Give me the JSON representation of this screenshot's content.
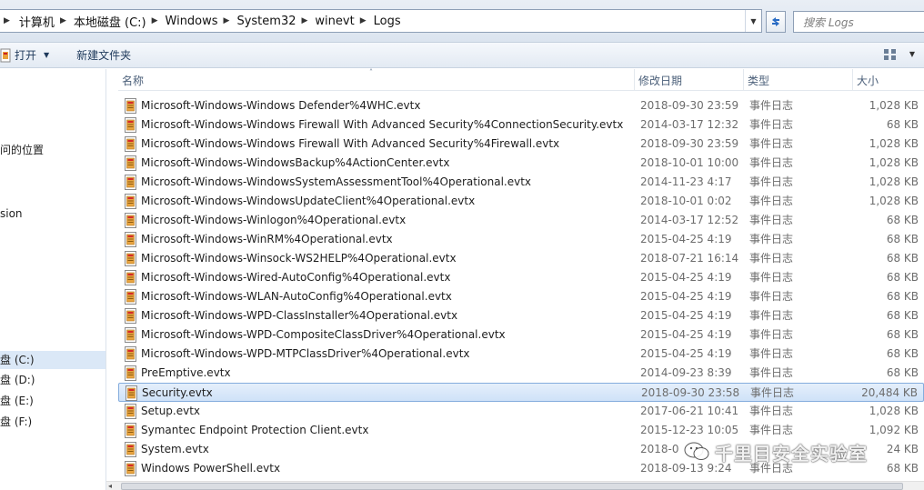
{
  "address_bar": {
    "crumbs": [
      "计算机",
      "本地磁盘 (C:)",
      "Windows",
      "System32",
      "winevt",
      "Logs"
    ]
  },
  "search": {
    "placeholder": "搜索 Logs"
  },
  "toolbar": {
    "open_label": "打开",
    "new_folder_label": "新建文件夹"
  },
  "nav": {
    "recent_places_partial": "问的位置",
    "partial_item": "sion",
    "drives": [
      {
        "label": "盘 (C:)",
        "selected": true
      },
      {
        "label": "盘 (D:)",
        "selected": false
      },
      {
        "label": "盘 (E:)",
        "selected": false
      },
      {
        "label": "盘 (F:)",
        "selected": false
      }
    ]
  },
  "columns": {
    "name": "名称",
    "date": "修改日期",
    "type": "类型",
    "size": "大小"
  },
  "files": [
    {
      "name": "Microsoft-Windows-Windows Defender%4WHC.evtx",
      "date": "2018-09-30 23:59",
      "type": "事件日志",
      "size": "1,028 KB"
    },
    {
      "name": "Microsoft-Windows-Windows Firewall With Advanced Security%4ConnectionSecurity.evtx",
      "date": "2014-03-17 12:32",
      "type": "事件日志",
      "size": "68 KB"
    },
    {
      "name": "Microsoft-Windows-Windows Firewall With Advanced Security%4Firewall.evtx",
      "date": "2018-09-30 23:59",
      "type": "事件日志",
      "size": "1,028 KB"
    },
    {
      "name": "Microsoft-Windows-WindowsBackup%4ActionCenter.evtx",
      "date": "2018-10-01 10:00",
      "type": "事件日志",
      "size": "1,028 KB"
    },
    {
      "name": "Microsoft-Windows-WindowsSystemAssessmentTool%4Operational.evtx",
      "date": "2014-11-23 4:17",
      "type": "事件日志",
      "size": "1,028 KB"
    },
    {
      "name": "Microsoft-Windows-WindowsUpdateClient%4Operational.evtx",
      "date": "2018-10-01 0:02",
      "type": "事件日志",
      "size": "1,028 KB"
    },
    {
      "name": "Microsoft-Windows-Winlogon%4Operational.evtx",
      "date": "2014-03-17 12:52",
      "type": "事件日志",
      "size": "68 KB"
    },
    {
      "name": "Microsoft-Windows-WinRM%4Operational.evtx",
      "date": "2015-04-25 4:19",
      "type": "事件日志",
      "size": "68 KB"
    },
    {
      "name": "Microsoft-Windows-Winsock-WS2HELP%4Operational.evtx",
      "date": "2018-07-21 16:14",
      "type": "事件日志",
      "size": "68 KB"
    },
    {
      "name": "Microsoft-Windows-Wired-AutoConfig%4Operational.evtx",
      "date": "2015-04-25 4:19",
      "type": "事件日志",
      "size": "68 KB"
    },
    {
      "name": "Microsoft-Windows-WLAN-AutoConfig%4Operational.evtx",
      "date": "2015-04-25 4:19",
      "type": "事件日志",
      "size": "68 KB"
    },
    {
      "name": "Microsoft-Windows-WPD-ClassInstaller%4Operational.evtx",
      "date": "2015-04-25 4:19",
      "type": "事件日志",
      "size": "68 KB"
    },
    {
      "name": "Microsoft-Windows-WPD-CompositeClassDriver%4Operational.evtx",
      "date": "2015-04-25 4:19",
      "type": "事件日志",
      "size": "68 KB"
    },
    {
      "name": "Microsoft-Windows-WPD-MTPClassDriver%4Operational.evtx",
      "date": "2015-04-25 4:19",
      "type": "事件日志",
      "size": "68 KB"
    },
    {
      "name": "PreEmptive.evtx",
      "date": "2014-09-23 8:39",
      "type": "事件日志",
      "size": "68 KB"
    },
    {
      "name": "Security.evtx",
      "date": "2018-09-30 23:58",
      "type": "事件日志",
      "size": "20,484 KB",
      "selected": true
    },
    {
      "name": "Setup.evtx",
      "date": "2017-06-21 10:41",
      "type": "事件日志",
      "size": "1,028 KB"
    },
    {
      "name": "Symantec Endpoint Protection Client.evtx",
      "date": "2015-12-23 10:05",
      "type": "事件日志",
      "size": "1,092 KB"
    },
    {
      "name": "System.evtx",
      "date": "2018-0",
      "type": "",
      "size": "24 KB"
    },
    {
      "name": "Windows PowerShell.evtx",
      "date": "2018-09-13 9:24",
      "type": "事件日志",
      "size": "68 KB"
    }
  ],
  "watermark": {
    "text": "千里目安全实验室"
  },
  "colors": {
    "selection_bg": "#cfe2f8",
    "selection_border": "#84acdd",
    "header_text": "#4c607a",
    "toolbar_text": "#1e395b"
  }
}
